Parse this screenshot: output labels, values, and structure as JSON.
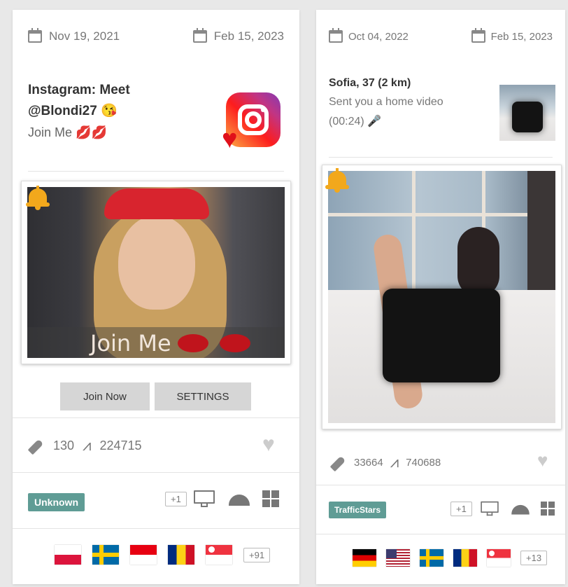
{
  "card1": {
    "date_start": "Nov 19, 2021",
    "date_end": "Feb 15, 2023",
    "title_line1": "Instagram: Meet",
    "title_line2": "@Blondi27 😘",
    "subtitle": "Join Me 💋💋",
    "banner_text": "Join Me",
    "join_button": "Join Now",
    "settings_button": "SETTINGS",
    "stat_impressions": "130",
    "stat_clicks": "224715",
    "badge": "Unknown",
    "platform_extra": "+1",
    "flags_extra": "+91",
    "flags": [
      "poland",
      "sweden",
      "indonesia",
      "romania",
      "singapore"
    ]
  },
  "card2": {
    "date_start": "Oct 04, 2022",
    "date_end": "Feb 15, 2023",
    "title": "Sofia, 37 (2 km)",
    "subtitle_line1": "Sent you a home video",
    "subtitle_line2": "(00:24) 🎤",
    "stat_impressions": "33664",
    "stat_clicks": "740688",
    "badge": "TrafficStars",
    "platform_extra": "+1",
    "flags_extra": "+13",
    "flags": [
      "germany",
      "usa",
      "sweden",
      "romania",
      "singapore"
    ]
  },
  "icons": {
    "calendar": "calendar-icon",
    "rocket": "rocket-icon",
    "trend": "trend-icon",
    "heart": "heart-icon",
    "bell": "bell-icon",
    "desktop": "desktop-icon",
    "android": "android-icon",
    "windows": "windows-icon"
  },
  "colors": {
    "badge_bg": "#5f9c95",
    "bell": "#f2a81c",
    "button_bg": "#d6d6d6"
  }
}
